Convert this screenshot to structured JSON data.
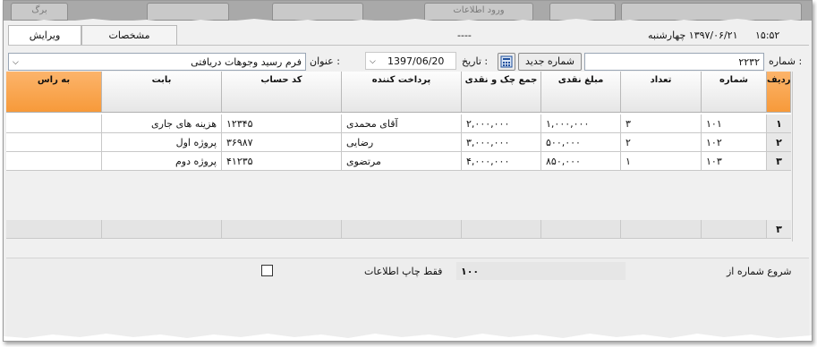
{
  "top_tabs": [
    "برگ",
    "ورود اطلاعات",
    "",
    "",
    ""
  ],
  "tabs": [
    {
      "label": "ویرایش",
      "active": true
    },
    {
      "label": "مشخصات",
      "active": false
    }
  ],
  "header": {
    "placeholder_dashes": "----",
    "date_text": "۱۳۹۷/۰۶/۲۱  چهارشنبه",
    "time_text": "۱۵:۵۲"
  },
  "form": {
    "number_label": "شماره :",
    "number_value": "۲۲۳۲",
    "new_number_button": "شماره جدید",
    "date_label": "تاریخ :",
    "date_value": "1397/06/20",
    "title_label": "عنوان :",
    "title_value": "فرم رسید وجوهات دریافتی"
  },
  "grid": {
    "columns": [
      "ردیف",
      "شماره",
      "تعداد",
      "مبلغ نقدی",
      "جمع چک و نقدی",
      "پرداخت کننده",
      "کد حساب",
      "بابت",
      "به راس"
    ],
    "rows": [
      {
        "idx": "۱",
        "number": "۱۰۱",
        "count": "۳",
        "cash": "۱,۰۰۰,۰۰۰",
        "total": "۲,۰۰۰,۰۰۰",
        "payer": "آقای محمدی",
        "account": "۱۲۳۴۵",
        "for": "هزینه های جاری",
        "due": ""
      },
      {
        "idx": "۲",
        "number": "۱۰۲",
        "count": "۲",
        "cash": "۵۰۰,۰۰۰",
        "total": "۳,۰۰۰,۰۰۰",
        "payer": "رضایی",
        "account": "۳۶۹۸۷",
        "for": "پروژه اول",
        "due": ""
      },
      {
        "idx": "۳",
        "number": "۱۰۳",
        "count": "۱",
        "cash": "۸۵۰,۰۰۰",
        "total": "۴,۰۰۰,۰۰۰",
        "payer": "مرتضوی",
        "account": "۴۱۲۳۵",
        "for": "پروژه دوم",
        "due": ""
      }
    ],
    "footer_count": "۳"
  },
  "bottom": {
    "start_number_label": "شروع شماره از",
    "start_number_value": "۱۰۰",
    "print_only_label": "فقط چاپ اطلاعات",
    "print_only_checked": false
  },
  "colors": {
    "header_orange": "#f79a3a",
    "accent_blue": "#1e4f9c"
  }
}
